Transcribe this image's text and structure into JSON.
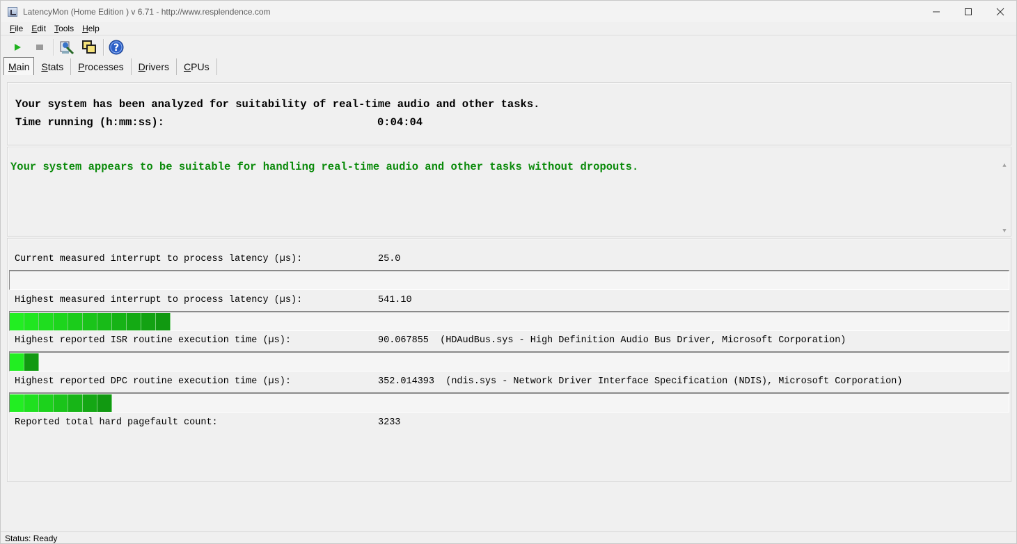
{
  "window": {
    "title": "LatencyMon  (Home Edition )  v 6.71 - http://www.resplendence.com"
  },
  "menu": [
    {
      "label": "File",
      "accel": "F",
      "rest": "ile"
    },
    {
      "label": "Edit",
      "accel": "E",
      "rest": "dit"
    },
    {
      "label": "Tools",
      "accel": "T",
      "rest": "ools"
    },
    {
      "label": "Help",
      "accel": "H",
      "rest": "elp"
    }
  ],
  "toolbar": {
    "icons": [
      "play-icon",
      "stop-icon",
      "drivers-icon",
      "windows-icon",
      "help-icon"
    ]
  },
  "tabs": [
    {
      "label": "Main",
      "accel": "M",
      "rest": "ain",
      "active": true
    },
    {
      "label": "Stats",
      "accel": "S",
      "rest": "tats",
      "active": false
    },
    {
      "label": "Processes",
      "accel": "P",
      "rest": "rocesses",
      "active": false
    },
    {
      "label": "Drivers",
      "accel": "D",
      "rest": "rivers",
      "active": false
    },
    {
      "label": "CPUs",
      "accel": "C",
      "rest": "PUs",
      "active": false
    }
  ],
  "summary": {
    "analyzed_text": "Your system has been analyzed for suitability of real-time audio and other tasks.",
    "time_running_label": "Time running (h:mm:ss):",
    "time_running_value": "0:04:04"
  },
  "verdict": {
    "text": "Your system appears to be suitable for handling real-time audio and other tasks without dropouts.",
    "color": "#0a8a0a"
  },
  "metrics": {
    "current_latency": {
      "label": "Current measured interrupt to process latency (µs):",
      "value": "25.0",
      "segments": 0
    },
    "highest_latency": {
      "label": "Highest measured interrupt to process latency (µs):",
      "value": "541.10",
      "segments": 11
    },
    "isr": {
      "label": "Highest reported ISR routine execution time (µs):",
      "value": "90.067855  (HDAudBus.sys - High Definition Audio Bus Driver, Microsoft Corporation)",
      "segments": 2
    },
    "dpc": {
      "label": "Highest reported DPC routine execution time (µs):",
      "value": "352.014393  (ndis.sys - Network Driver Interface Specification (NDIS), Microsoft Corporation)",
      "segments": 7
    },
    "pagefault": {
      "label": "Reported total hard pagefault count:",
      "value": "3233"
    }
  },
  "colors": {
    "bar_light": "#22ee22",
    "bar_dark": "#119911"
  },
  "status": {
    "text": "Status: Ready"
  }
}
